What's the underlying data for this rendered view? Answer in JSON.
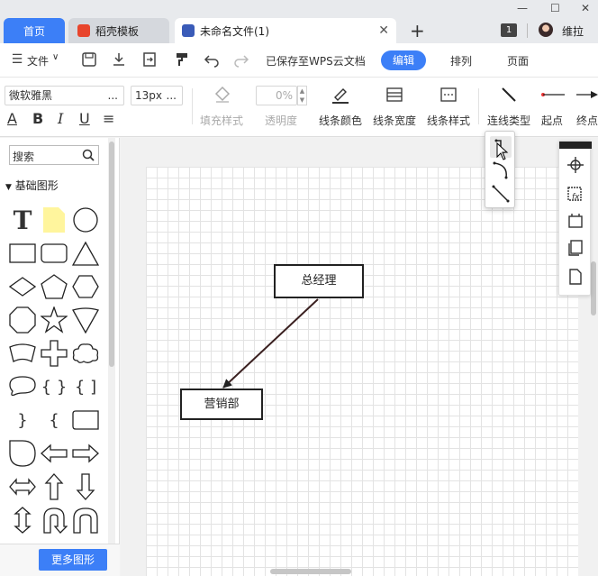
{
  "tabs": {
    "home": "首页",
    "template": "稻壳模板",
    "document": "未命名文件(1)"
  },
  "window": {
    "badge": "1",
    "user_name": "维拉"
  },
  "menubar": {
    "file": "文件",
    "save_status": "已保存至WPS云文档",
    "edit": "编辑",
    "arrange": "排列",
    "page": "页面"
  },
  "toolbar": {
    "font_family": "微软雅黑",
    "font_size": "13px",
    "opacity": "0%",
    "fill_style": "填充样式",
    "transparency": "透明度",
    "line_color": "线条颜色",
    "line_width": "线条宽度",
    "line_style": "线条样式",
    "connector_type": "连线类型",
    "start_point": "起点",
    "end_point": "终点",
    "format_more": "..."
  },
  "left_panel": {
    "search_placeholder": "搜索",
    "section_title": "基础图形",
    "more_shapes": "更多图形"
  },
  "diagram": {
    "node_manager": "总经理",
    "node_marketing": "营销部",
    "edge_color": "#3a2020"
  },
  "colors": {
    "accent": "#3c7ff7",
    "note_yellow": "#fff59d"
  }
}
